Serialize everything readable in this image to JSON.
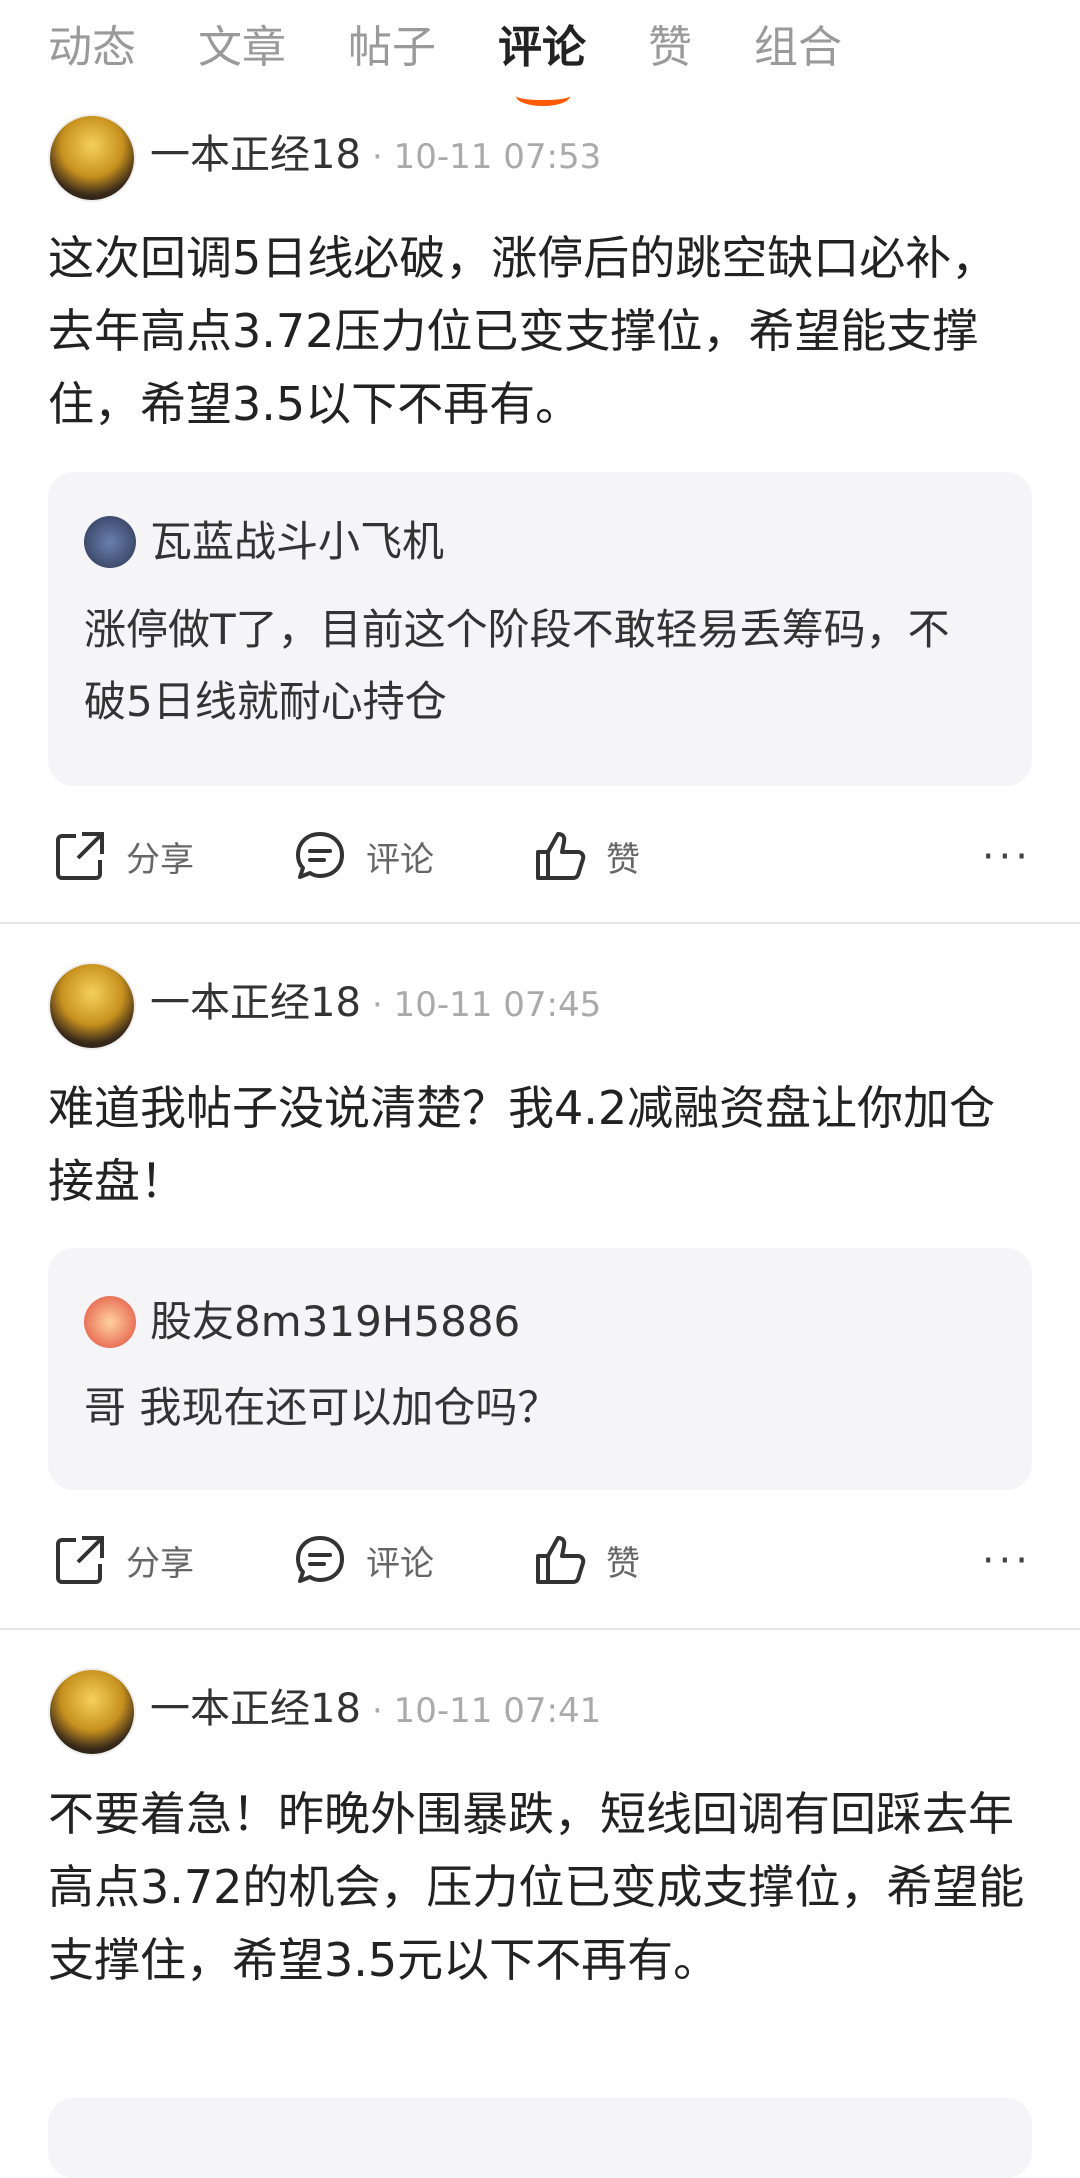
{
  "tabs": [
    {
      "label": "动态",
      "active": false
    },
    {
      "label": "文章",
      "active": false
    },
    {
      "label": "帖子",
      "active": false
    },
    {
      "label": "评论",
      "active": true
    },
    {
      "label": "赞",
      "active": false
    },
    {
      "label": "组合",
      "active": false
    }
  ],
  "accent_color": "#ff5a00",
  "posts": [
    {
      "author": "一本正经18",
      "time": "· 10-11 07:53",
      "text": "这次回调5日线必破，涨停后的跳空缺口必补，去年高点3.72压力位已变支撑位，希望能支撑住，希望3.5以下不再有。",
      "quote": {
        "author": "瓦蓝战斗小飞机",
        "text": "涨停做T了，目前这个阶段不敢轻易丢筹码，不破5日线就耐心持仓"
      }
    },
    {
      "author": "一本正经18",
      "time": "· 10-11 07:45",
      "text": "难道我帖子没说清楚？我4.2减融资盘让你加仓接盘！",
      "quote": {
        "author": "股友8m319H5886",
        "text": "哥 我现在还可以加仓吗？"
      }
    },
    {
      "author": "一本正经18",
      "time": "· 10-11 07:41",
      "text": "不要着急！昨晚外围暴跌，短线回调有回踩去年高点3.72的机会，压力位已变成支撑位，希望能支撑住，希望3.5元以下不再有。"
    }
  ],
  "actions": {
    "share": "分享",
    "comment": "评论",
    "like": "赞",
    "more": "···"
  }
}
